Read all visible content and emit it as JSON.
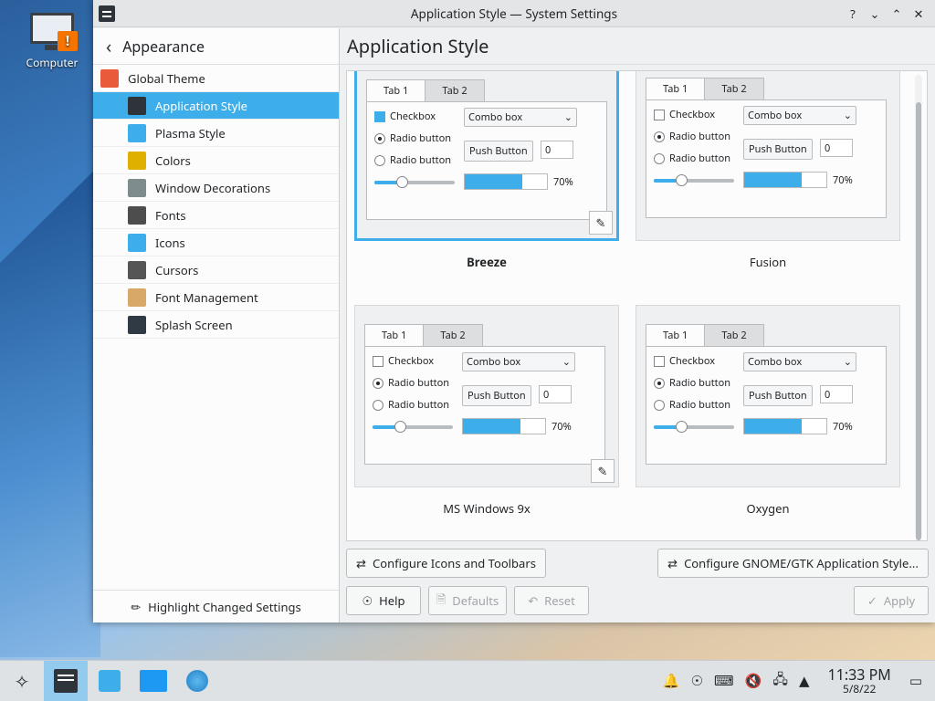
{
  "desktop": {
    "computer_label": "Computer"
  },
  "window": {
    "title": "Application Style — System Settings"
  },
  "sidebar": {
    "header": "Appearance",
    "items": [
      {
        "label": "Global Theme",
        "icon": "global-theme-icon",
        "color": "#e85a3a"
      },
      {
        "label": "Application Style",
        "icon": "application-style-icon",
        "color": "#2f343a"
      },
      {
        "label": "Plasma Style",
        "icon": "plasma-style-icon",
        "color": "#3daee9"
      },
      {
        "label": "Colors",
        "icon": "colors-icon",
        "color": "#e0b000"
      },
      {
        "label": "Window Decorations",
        "icon": "window-decorations-icon",
        "color": "#7f8c8d"
      },
      {
        "label": "Fonts",
        "icon": "fonts-icon",
        "color": "#4d4d4d"
      },
      {
        "label": "Icons",
        "icon": "icons-icon",
        "color": "#3daee9"
      },
      {
        "label": "Cursors",
        "icon": "cursors-icon",
        "color": "#555"
      },
      {
        "label": "Font Management",
        "icon": "font-management-icon",
        "color": "#d8a868"
      },
      {
        "label": "Splash Screen",
        "icon": "splash-screen-icon",
        "color": "#2f3a44"
      }
    ],
    "footer": "Highlight Changed Settings"
  },
  "main": {
    "title": "Application Style"
  },
  "preview": {
    "tab1": "Tab 1",
    "tab2": "Tab 2",
    "checkbox": "Checkbox",
    "radio": "Radio button",
    "combo": "Combo box",
    "push": "Push Button",
    "spin": "0",
    "progress": "70%",
    "progress_value": 0.7
  },
  "styles": [
    {
      "name": "Breeze",
      "selected": true
    },
    {
      "name": "Fusion",
      "selected": false
    },
    {
      "name": "MS Windows 9x",
      "selected": false
    },
    {
      "name": "Oxygen",
      "selected": false
    }
  ],
  "buttons": {
    "configure_icons": "Configure Icons and Toolbars",
    "configure_gtk": "Configure GNOME/GTK Application Style...",
    "help": "Help",
    "defaults": "Defaults",
    "reset": "Reset",
    "apply": "Apply"
  },
  "taskbar": {
    "time": "11:33 PM",
    "date": "5/8/22"
  },
  "colors": {
    "accent": "#3daee9"
  }
}
